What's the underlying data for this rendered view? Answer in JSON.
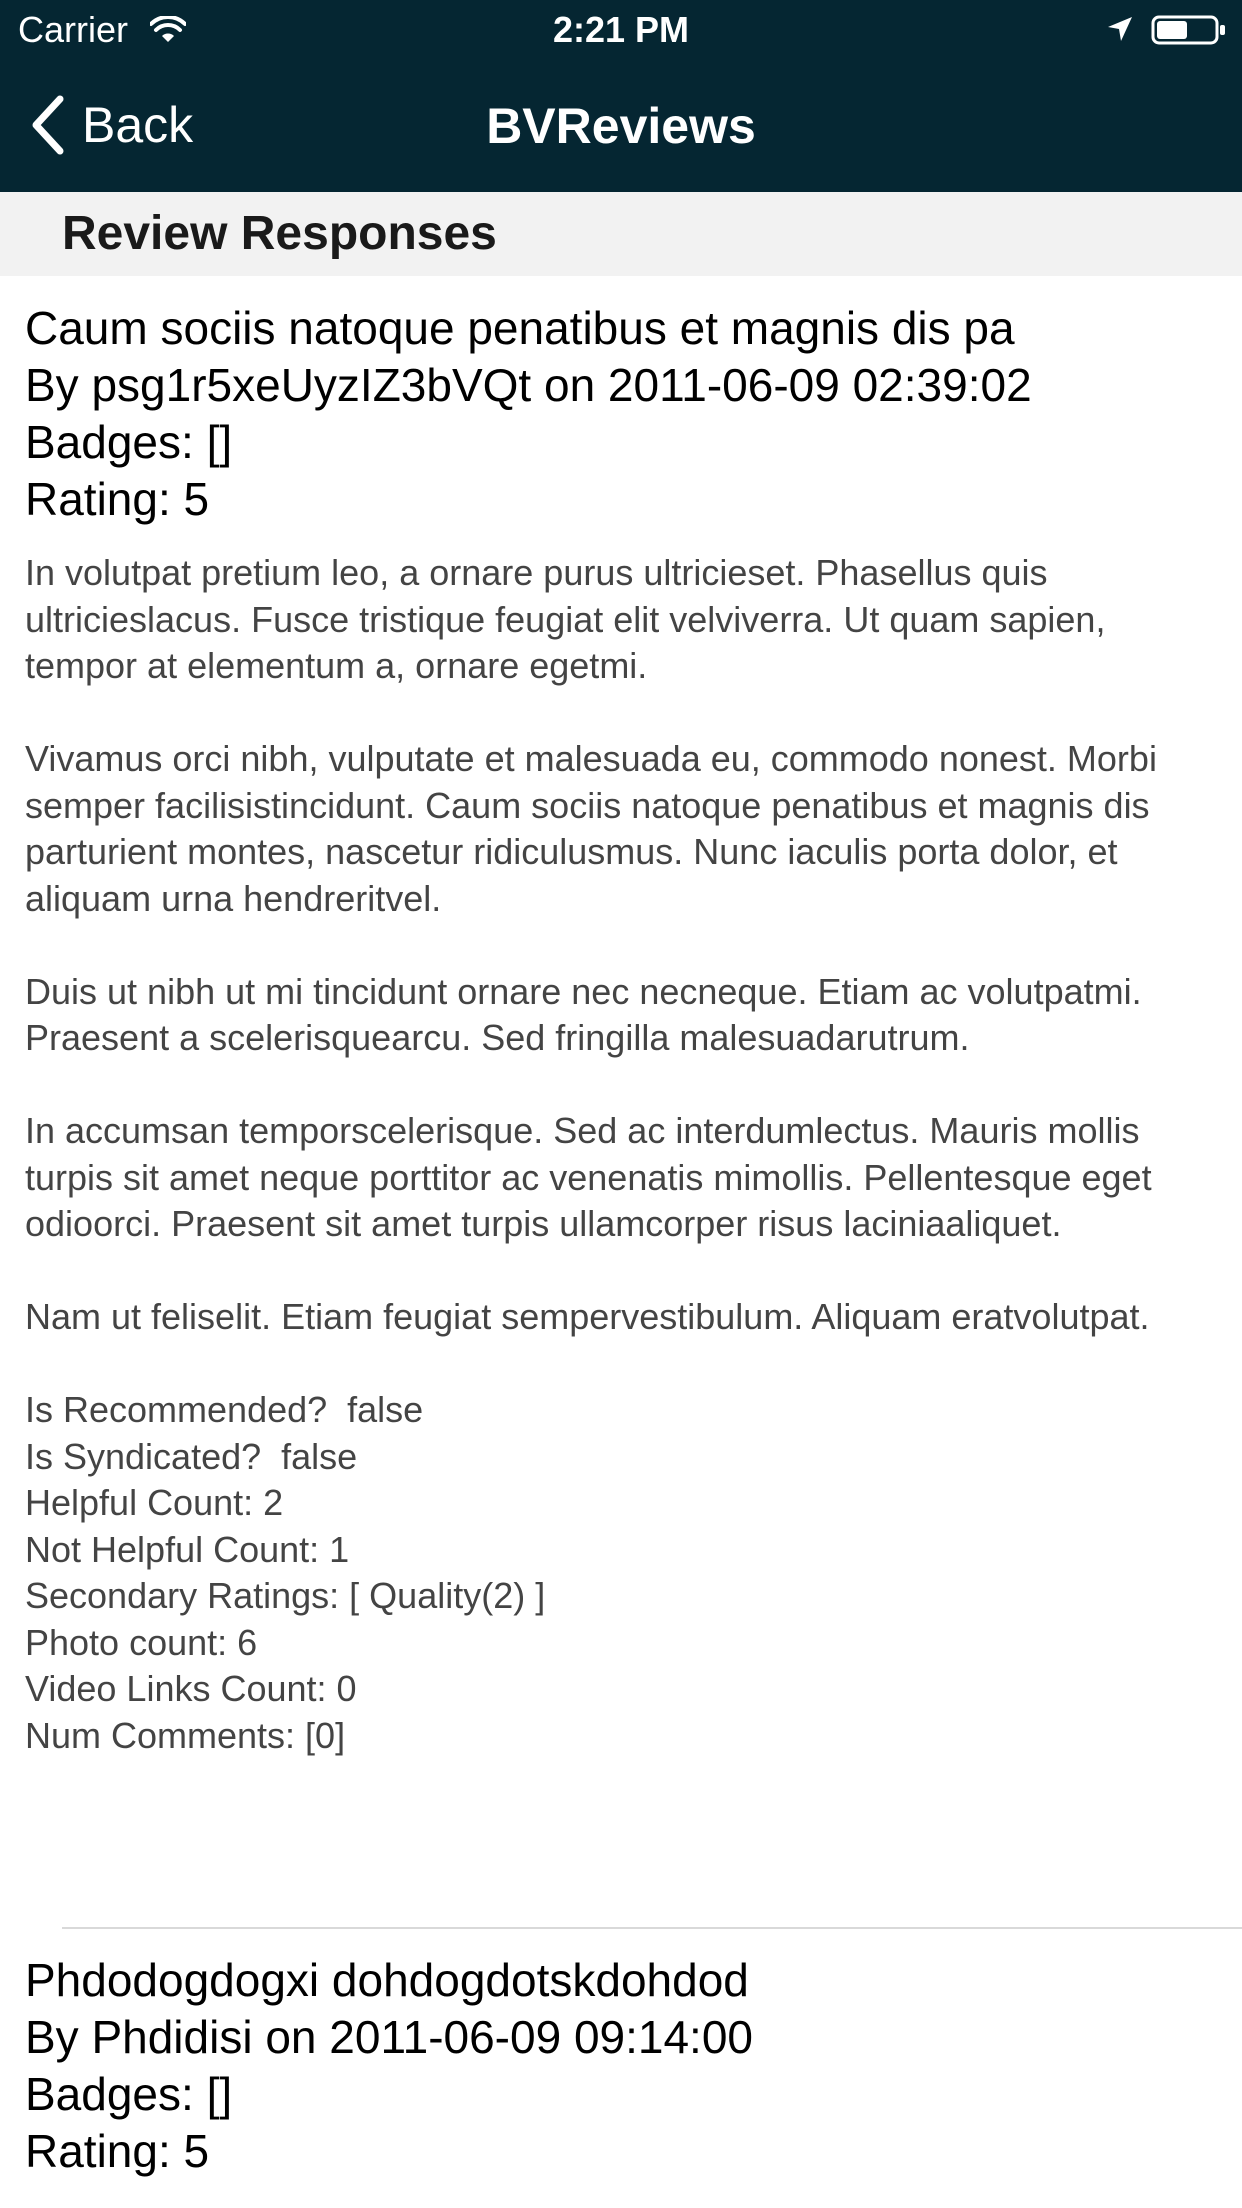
{
  "status_bar": {
    "carrier": "Carrier",
    "time": "2:21 PM",
    "icons": [
      "wifi-icon",
      "location-arrow-icon",
      "battery-icon"
    ]
  },
  "nav": {
    "back_label": "Back",
    "title": "BVReviews",
    "background_color": "#052632"
  },
  "section": {
    "title": "Review Responses"
  },
  "reviews": [
    {
      "title": "Caum sociis natoque penatibus et magnis dis pa",
      "author_line": "By psg1r5xeUyzIZ3bVQt on 2011-06-09 02:39:02",
      "badges": "Badges: []",
      "rating": "Rating: 5",
      "paragraphs": [
        "In volutpat pretium leo, a ornare purus ultricieset. Phasellus quis ultricieslacus. Fusce tristique feugiat elit velviverra. Ut quam sapien, tempor at elementum a, ornare egetmi.",
        "Vivamus orci nibh, vulputate et malesuada eu, commodo nonest. Morbi semper facilisistincidunt. Caum sociis natoque penatibus et magnis dis parturient montes, nascetur ridiculusmus. Nunc iaculis porta dolor, et aliquam urna hendreritvel.",
        "Duis ut nibh ut mi tincidunt ornare nec necneque. Etiam ac volutpatmi. Praesent a scelerisquearcu. Sed fringilla malesuadarutrum.",
        "In accumsan temporscelerisque. Sed ac interdumlectus. Mauris mollis turpis sit amet neque porttitor ac venenatis mimollis. Pellentesque eget odioorci. Praesent sit amet turpis ullamcorper risus laciniaaliquet.",
        "Nam ut feliselit. Etiam feugiat sempervestibulum. Aliquam eratvolutpat."
      ],
      "meta": [
        "Is Recommended?  false",
        "Is Syndicated?  false",
        "Helpful Count: 2",
        "Not Helpful Count: 1",
        "Secondary Ratings: [ Quality(2) ]",
        "Photo count: 6",
        "Video Links Count: 0",
        "Num Comments: [0]"
      ]
    },
    {
      "title": "Phdodogdogxi dohdogdotskdohdod",
      "author_line": "By Phdidisi on 2011-06-09 09:14:00",
      "badges": "Badges: []",
      "rating": "Rating: 5"
    }
  ]
}
